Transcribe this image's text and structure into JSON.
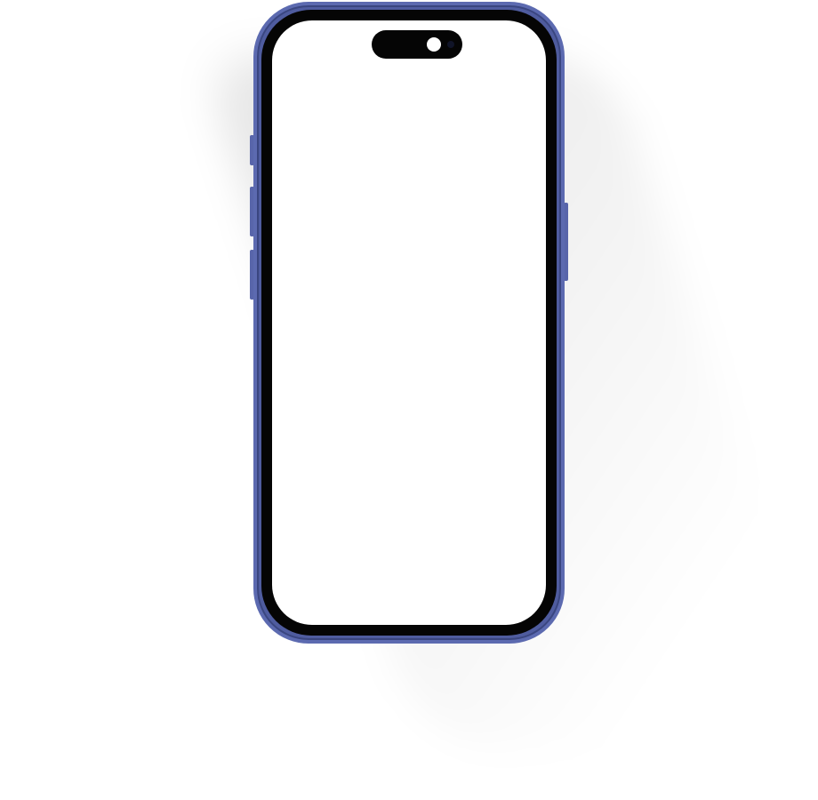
{
  "device": {
    "frame_color": "#5c6ab0",
    "bezel_color": "#050505",
    "screen_color": "#ffffff",
    "island_color": "#050505",
    "camera_color": "#ffffff"
  }
}
